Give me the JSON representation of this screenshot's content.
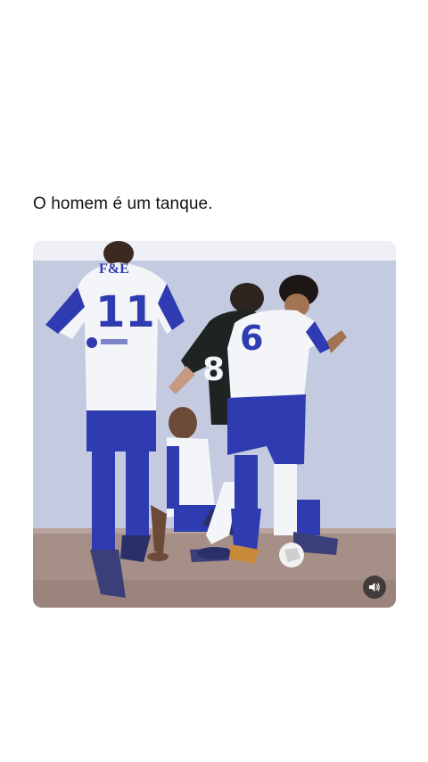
{
  "post": {
    "text": "O homem é um tanque."
  },
  "video": {
    "player_left_number": "11",
    "player_center_number": "8",
    "player_right_number": "6",
    "jersey_sponsor": "F&E",
    "sound_icon": "speaker-icon",
    "colors": {
      "white_kit_trim": "#2f3bb0",
      "dark_kit": "#1d2422",
      "floor": "#a58f86"
    }
  }
}
